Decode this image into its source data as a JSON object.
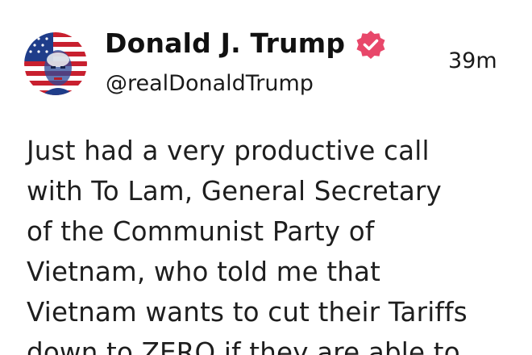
{
  "author": {
    "display_name": "Donald J. Trump",
    "handle": "@realDonaldTrump",
    "verified_icon": "verified-badge-icon",
    "avatar": "profile-avatar-flag-portrait"
  },
  "post": {
    "timestamp": "39m",
    "lines": [
      "Just had a very productive call",
      "with To Lam, General Secretary",
      "of the Communist Party of",
      "Vietnam, who told me that",
      "Vietnam wants to cut their Tariffs",
      "down to ZERO if they are able to"
    ]
  },
  "colors": {
    "badge": "#e8476a",
    "text": "#1e1e1e",
    "background": "#ffffff"
  }
}
